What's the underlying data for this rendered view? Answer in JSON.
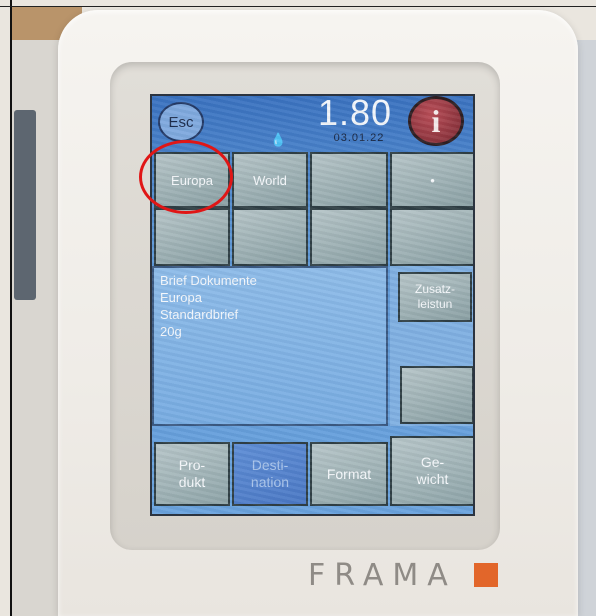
{
  "header": {
    "esc_label": "Esc",
    "amount": "1.80",
    "date": "03.01.22",
    "info_label": "i",
    "drop_icon": "droplets-icon"
  },
  "destination_grid": {
    "tiles": [
      "Europa",
      "World",
      "",
      "•",
      "",
      "",
      "",
      ""
    ]
  },
  "details": {
    "lines": [
      "Brief Dokumente",
      "Europa",
      "Standardbrief",
      "20g"
    ]
  },
  "side": {
    "extras_label": "Zusatz-\nleistun",
    "empty_label": ""
  },
  "bottom_nav": {
    "product": "Pro-\ndukt",
    "destination": "Desti-\nnation",
    "format": "Format",
    "weight": "Ge-\nwicht",
    "active": "destination"
  },
  "brand": "FRAMA",
  "colors": {
    "brand_accent": "#e2662a",
    "highlight": "#e01616",
    "screen": "#5d97d6"
  }
}
